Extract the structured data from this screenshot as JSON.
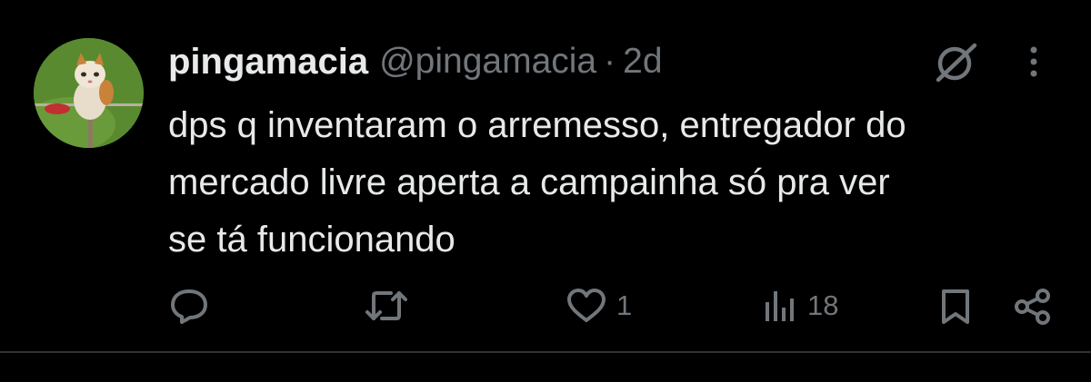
{
  "post": {
    "display_name": "pingamacia",
    "handle": "@pingamacia",
    "separator": "·",
    "time": "2d",
    "text": "dps q inventaram o arremesso, entregador do\nmercado livre aperta a campainha só pra ver\nse tá funcionando"
  },
  "actions": {
    "reply_count": "",
    "repost_count": "",
    "like_count": "1",
    "views_count": "18"
  },
  "icons": {
    "grok": "grok-icon",
    "more": "more-icon",
    "reply": "reply-icon",
    "repost": "repost-icon",
    "like": "heart-icon",
    "views": "views-icon",
    "bookmark": "bookmark-icon",
    "share": "share-icon"
  },
  "colors": {
    "background": "#000000",
    "text": "#e7e9ea",
    "muted": "#71767b",
    "divider": "#2f3336"
  }
}
